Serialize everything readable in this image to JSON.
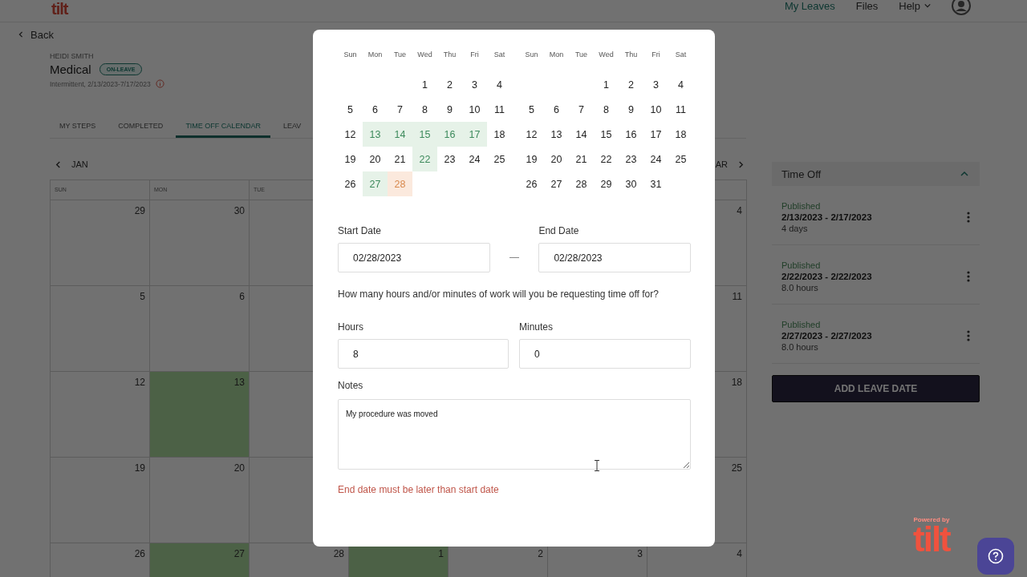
{
  "header": {
    "logo": "tilt",
    "nav": [
      {
        "label": "My Leaves",
        "selected": true,
        "kind": "link"
      },
      {
        "label": "Files",
        "selected": false,
        "kind": "link"
      },
      {
        "label": "Help",
        "selected": false,
        "kind": "dropdown"
      }
    ]
  },
  "back": "Back",
  "leave": {
    "person": "HEIDI SMITH",
    "type": "Medical",
    "badge": "ON-LEAVE",
    "dates": "Intermittent, 2/13/2023-7/17/2023"
  },
  "tabs": [
    {
      "label": "MY STEPS",
      "selected": false
    },
    {
      "label": "COMPLETED",
      "selected": false
    },
    {
      "label": "TIME OFF CALENDAR",
      "selected": true
    },
    {
      "label": "LEAV",
      "selected": false
    }
  ],
  "calendar": {
    "prev_month": "JAN",
    "next_month": "AR",
    "weekdays": [
      "SUN",
      "MON",
      "TUE"
    ],
    "weeks": [
      [
        {
          "day": "29",
          "on_leave": false
        },
        {
          "day": "30",
          "on_leave": false
        },
        {
          "day": "4",
          "on_leave": false
        }
      ],
      [
        {
          "day": "5",
          "on_leave": false
        },
        {
          "day": "6",
          "on_leave": false
        },
        {
          "day": "11",
          "on_leave": false
        }
      ],
      [
        {
          "day": "12",
          "on_leave": false
        },
        {
          "day": "13",
          "on_leave": true
        },
        {
          "day": "18",
          "on_leave": false
        }
      ],
      [
        {
          "day": "19",
          "on_leave": false
        },
        {
          "day": "20",
          "on_leave": false
        },
        {
          "day": "25",
          "on_leave": false
        }
      ],
      [
        {
          "day": "26",
          "on_leave": false
        },
        {
          "day": "27",
          "on_leave": true
        },
        {
          "day": "28",
          "on_leave": false
        },
        {
          "day": "1",
          "on_leave": true
        },
        {
          "day": "2",
          "on_leave": false
        },
        {
          "day": "3",
          "on_leave": false
        },
        {
          "day": "4",
          "on_leave": false
        }
      ]
    ]
  },
  "time_off": {
    "title": "Time Off",
    "expanded": true,
    "entries": [
      {
        "status": "Published",
        "range": "2/13/2023 - 2/17/2023",
        "amount": "4 days"
      },
      {
        "status": "Published",
        "range": "2/22/2023 - 2/22/2023",
        "amount": "8.0 hours"
      },
      {
        "status": "Published",
        "range": "2/27/2023 - 2/27/2023",
        "amount": "8.0 hours"
      }
    ],
    "button": "ADD LEAVE DATE"
  },
  "footer": {
    "powered_by": "Powered by",
    "logo": "tilt"
  },
  "modal": {
    "months": [
      {
        "weekdays": [
          "Sun",
          "Mon",
          "Tue",
          "Wed",
          "Thu",
          "Fri",
          "Sat"
        ],
        "weeks": [
          [
            {
              "day": "1",
              "on_leave": false,
              "selected": false
            },
            {
              "day": "2",
              "on_leave": false,
              "selected": false
            },
            {
              "day": "3",
              "on_leave": false,
              "selected": false
            },
            {
              "day": "4",
              "on_leave": false,
              "selected": false
            }
          ],
          [
            {
              "day": "5",
              "on_leave": false,
              "selected": false
            },
            {
              "day": "6",
              "on_leave": false,
              "selected": false
            },
            {
              "day": "7",
              "on_leave": false,
              "selected": false
            },
            {
              "day": "8",
              "on_leave": false,
              "selected": false
            },
            {
              "day": "9",
              "on_leave": false,
              "selected": false
            },
            {
              "day": "10",
              "on_leave": false,
              "selected": false
            },
            {
              "day": "11",
              "on_leave": false,
              "selected": false
            }
          ],
          [
            {
              "day": "12",
              "on_leave": false,
              "selected": false
            },
            {
              "day": "13",
              "on_leave": true,
              "selected": false
            },
            {
              "day": "14",
              "on_leave": true,
              "selected": false
            },
            {
              "day": "15",
              "on_leave": true,
              "selected": false
            },
            {
              "day": "16",
              "on_leave": true,
              "selected": false
            },
            {
              "day": "17",
              "on_leave": true,
              "selected": false
            },
            {
              "day": "18",
              "on_leave": false,
              "selected": false
            }
          ],
          [
            {
              "day": "19",
              "on_leave": false,
              "selected": false
            },
            {
              "day": "20",
              "on_leave": false,
              "selected": false
            },
            {
              "day": "21",
              "on_leave": false,
              "selected": false
            },
            {
              "day": "22",
              "on_leave": true,
              "selected": false
            },
            {
              "day": "23",
              "on_leave": false,
              "selected": false
            },
            {
              "day": "24",
              "on_leave": false,
              "selected": false
            },
            {
              "day": "25",
              "on_leave": false,
              "selected": false
            }
          ],
          [
            {
              "day": "26",
              "on_leave": false,
              "selected": false
            },
            {
              "day": "27",
              "on_leave": true,
              "selected": false
            },
            {
              "day": "28",
              "on_leave": false,
              "selected": true
            }
          ]
        ]
      },
      {
        "weekdays": [
          "Sun",
          "Mon",
          "Tue",
          "Wed",
          "Thu",
          "Fri",
          "Sat"
        ],
        "weeks": [
          [
            {
              "day": "1",
              "on_leave": false,
              "selected": false
            },
            {
              "day": "2",
              "on_leave": false,
              "selected": false
            },
            {
              "day": "3",
              "on_leave": false,
              "selected": false
            },
            {
              "day": "4",
              "on_leave": false,
              "selected": false
            }
          ],
          [
            {
              "day": "5",
              "on_leave": false,
              "selected": false
            },
            {
              "day": "6",
              "on_leave": false,
              "selected": false
            },
            {
              "day": "7",
              "on_leave": false,
              "selected": false
            },
            {
              "day": "8",
              "on_leave": false,
              "selected": false
            },
            {
              "day": "9",
              "on_leave": false,
              "selected": false
            },
            {
              "day": "10",
              "on_leave": false,
              "selected": false
            },
            {
              "day": "11",
              "on_leave": false,
              "selected": false
            }
          ],
          [
            {
              "day": "12",
              "on_leave": false,
              "selected": false
            },
            {
              "day": "13",
              "on_leave": false,
              "selected": false
            },
            {
              "day": "14",
              "on_leave": false,
              "selected": false
            },
            {
              "day": "15",
              "on_leave": false,
              "selected": false
            },
            {
              "day": "16",
              "on_leave": false,
              "selected": false
            },
            {
              "day": "17",
              "on_leave": false,
              "selected": false
            },
            {
              "day": "18",
              "on_leave": false,
              "selected": false
            }
          ],
          [
            {
              "day": "19",
              "on_leave": false,
              "selected": false
            },
            {
              "day": "20",
              "on_leave": false,
              "selected": false
            },
            {
              "day": "21",
              "on_leave": false,
              "selected": false
            },
            {
              "day": "22",
              "on_leave": false,
              "selected": false
            },
            {
              "day": "23",
              "on_leave": false,
              "selected": false
            },
            {
              "day": "24",
              "on_leave": false,
              "selected": false
            },
            {
              "day": "25",
              "on_leave": false,
              "selected": false
            }
          ],
          [
            {
              "day": "26",
              "on_leave": false,
              "selected": false
            },
            {
              "day": "27",
              "on_leave": false,
              "selected": false
            },
            {
              "day": "28",
              "on_leave": false,
              "selected": false
            },
            {
              "day": "29",
              "on_leave": false,
              "selected": false
            },
            {
              "day": "30",
              "on_leave": false,
              "selected": false
            },
            {
              "day": "31",
              "on_leave": false,
              "selected": false
            }
          ]
        ]
      }
    ],
    "start_date": {
      "label": "Start Date",
      "value": "02/28/2023"
    },
    "separator": "—",
    "end_date": {
      "label": "End Date",
      "value": "02/28/2023"
    },
    "question": "How many hours and/or minutes of work will you be requesting time off for?",
    "hours": {
      "label": "Hours",
      "value": "8"
    },
    "minutes": {
      "label": "Minutes",
      "value": "0"
    },
    "notes": {
      "label": "Notes",
      "value": "My procedure was moved"
    },
    "error": "End date must be later than start date"
  }
}
